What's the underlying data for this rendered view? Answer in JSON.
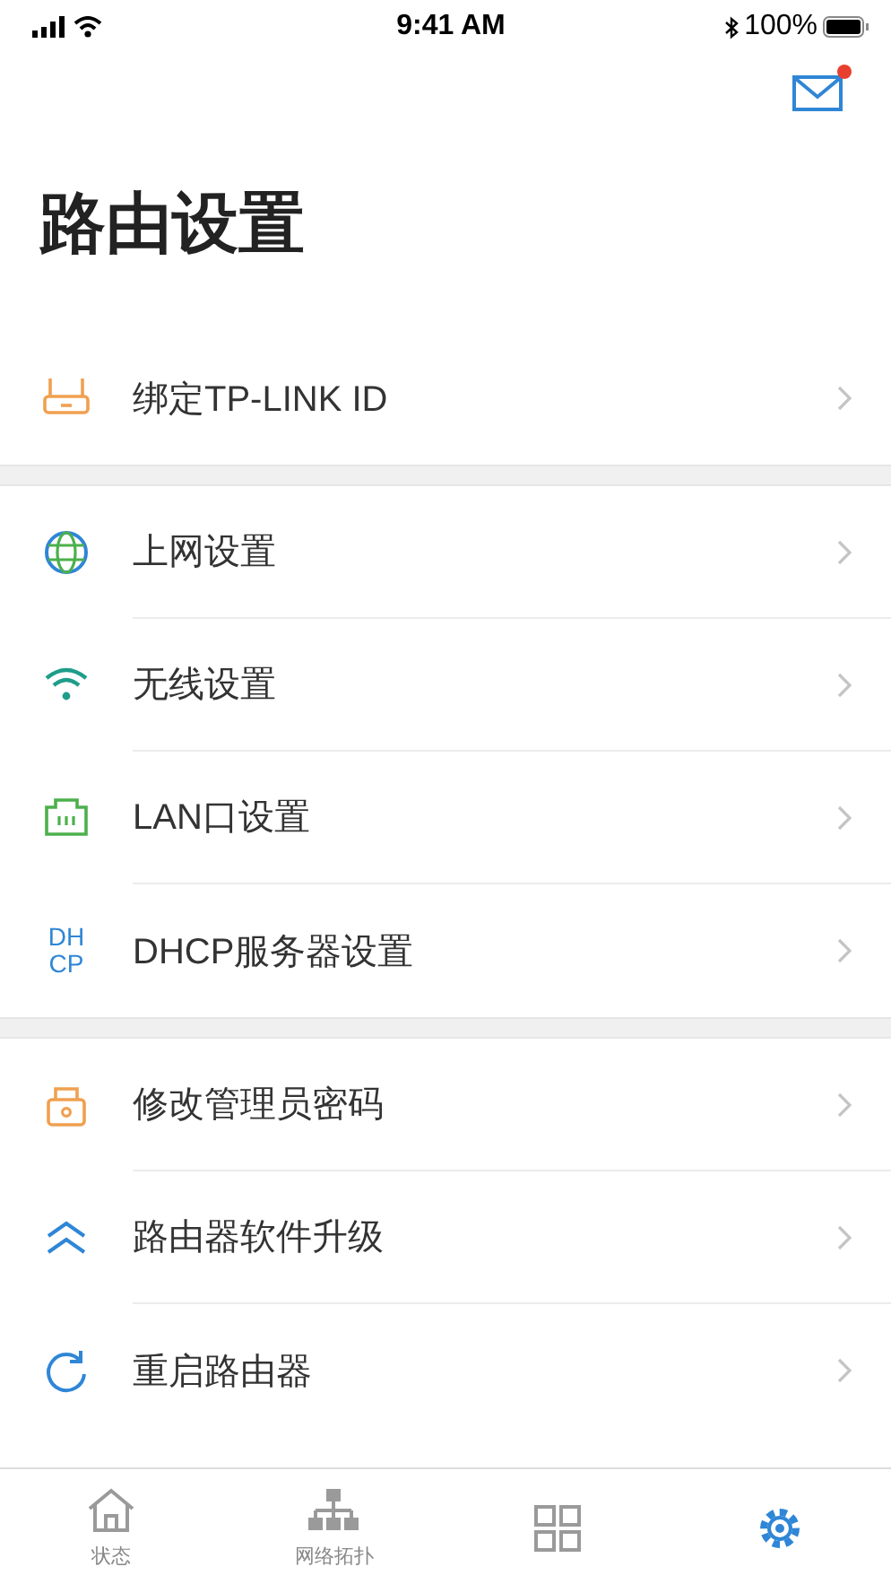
{
  "status_bar": {
    "time": "9:41 AM",
    "battery": "100%"
  },
  "header": {
    "mail_unread": true
  },
  "title": "路由设置",
  "groups": [
    {
      "items": [
        {
          "label": "绑定TP-LINK ID"
        }
      ]
    },
    {
      "items": [
        {
          "label": "上网设置"
        },
        {
          "label": "无线设置"
        },
        {
          "label": "LAN口设置"
        },
        {
          "icon_text": [
            "DH",
            "CP"
          ],
          "label": "DHCP服务器设置"
        }
      ]
    },
    {
      "items": [
        {
          "label": "修改管理员密码"
        },
        {
          "label": "路由器软件升级"
        },
        {
          "label": "重启路由器"
        }
      ]
    }
  ],
  "tab_bar": [
    {
      "label": "状态",
      "selected": false
    },
    {
      "label": "网络拓扑",
      "selected": false
    },
    {
      "selected": false
    },
    {
      "selected": true
    }
  ]
}
